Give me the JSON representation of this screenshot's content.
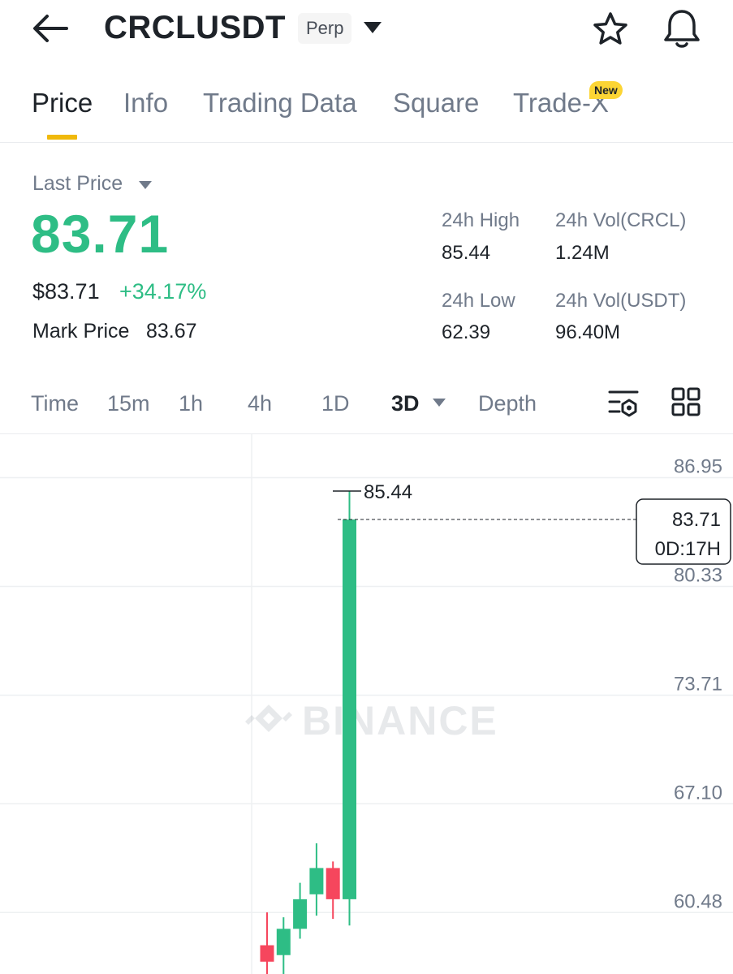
{
  "header": {
    "symbol": "CRCLUSDT",
    "contract_type": "Perp"
  },
  "tabs": [
    {
      "label": "Price",
      "active": true
    },
    {
      "label": "Info"
    },
    {
      "label": "Trading Data"
    },
    {
      "label": "Square"
    },
    {
      "label": "Trade-X",
      "badge": "New"
    }
  ],
  "price": {
    "label": "Last Price",
    "last": "83.71",
    "usd": "$83.71",
    "change": "+34.17%",
    "mark_label": "Mark Price",
    "mark_value": "83.67"
  },
  "stats": {
    "high_label": "24h High",
    "high_value": "85.44",
    "low_label": "24h Low",
    "low_value": "62.39",
    "vol_base_label": "24h Vol(CRCL)",
    "vol_base_value": "1.24M",
    "vol_quote_label": "24h Vol(USDT)",
    "vol_quote_value": "96.40M"
  },
  "intervals": [
    {
      "label": "Time"
    },
    {
      "label": "15m"
    },
    {
      "label": "1h"
    },
    {
      "label": "4h"
    },
    {
      "label": "1D"
    },
    {
      "label": "3D",
      "active": true
    },
    {
      "label": "Depth"
    }
  ],
  "colors": {
    "up": "#2ebd85",
    "down": "#f6465d",
    "accent": "#f0b90b"
  },
  "chart_data": {
    "type": "candlestick",
    "y_ticks": [
      "86.95",
      "80.33",
      "73.71",
      "67.10",
      "60.48"
    ],
    "ylim": [
      56.0,
      88.9
    ],
    "watermark": "BINANCE",
    "high_marker": "85.44",
    "current_price": "83.71",
    "countdown": "0D:17H",
    "candles": [
      {
        "open": 57.8,
        "high": 59.8,
        "low": 56.0,
        "close": 56.8
      },
      {
        "open": 57.2,
        "high": 59.5,
        "low": 56.0,
        "close": 58.8
      },
      {
        "open": 58.8,
        "high": 61.6,
        "low": 58.2,
        "close": 60.6
      },
      {
        "open": 60.9,
        "high": 64.0,
        "low": 59.6,
        "close": 62.5
      },
      {
        "open": 62.5,
        "high": 62.9,
        "low": 59.4,
        "close": 60.6
      },
      {
        "open": 60.6,
        "high": 85.44,
        "low": 59.0,
        "close": 83.71
      }
    ]
  }
}
